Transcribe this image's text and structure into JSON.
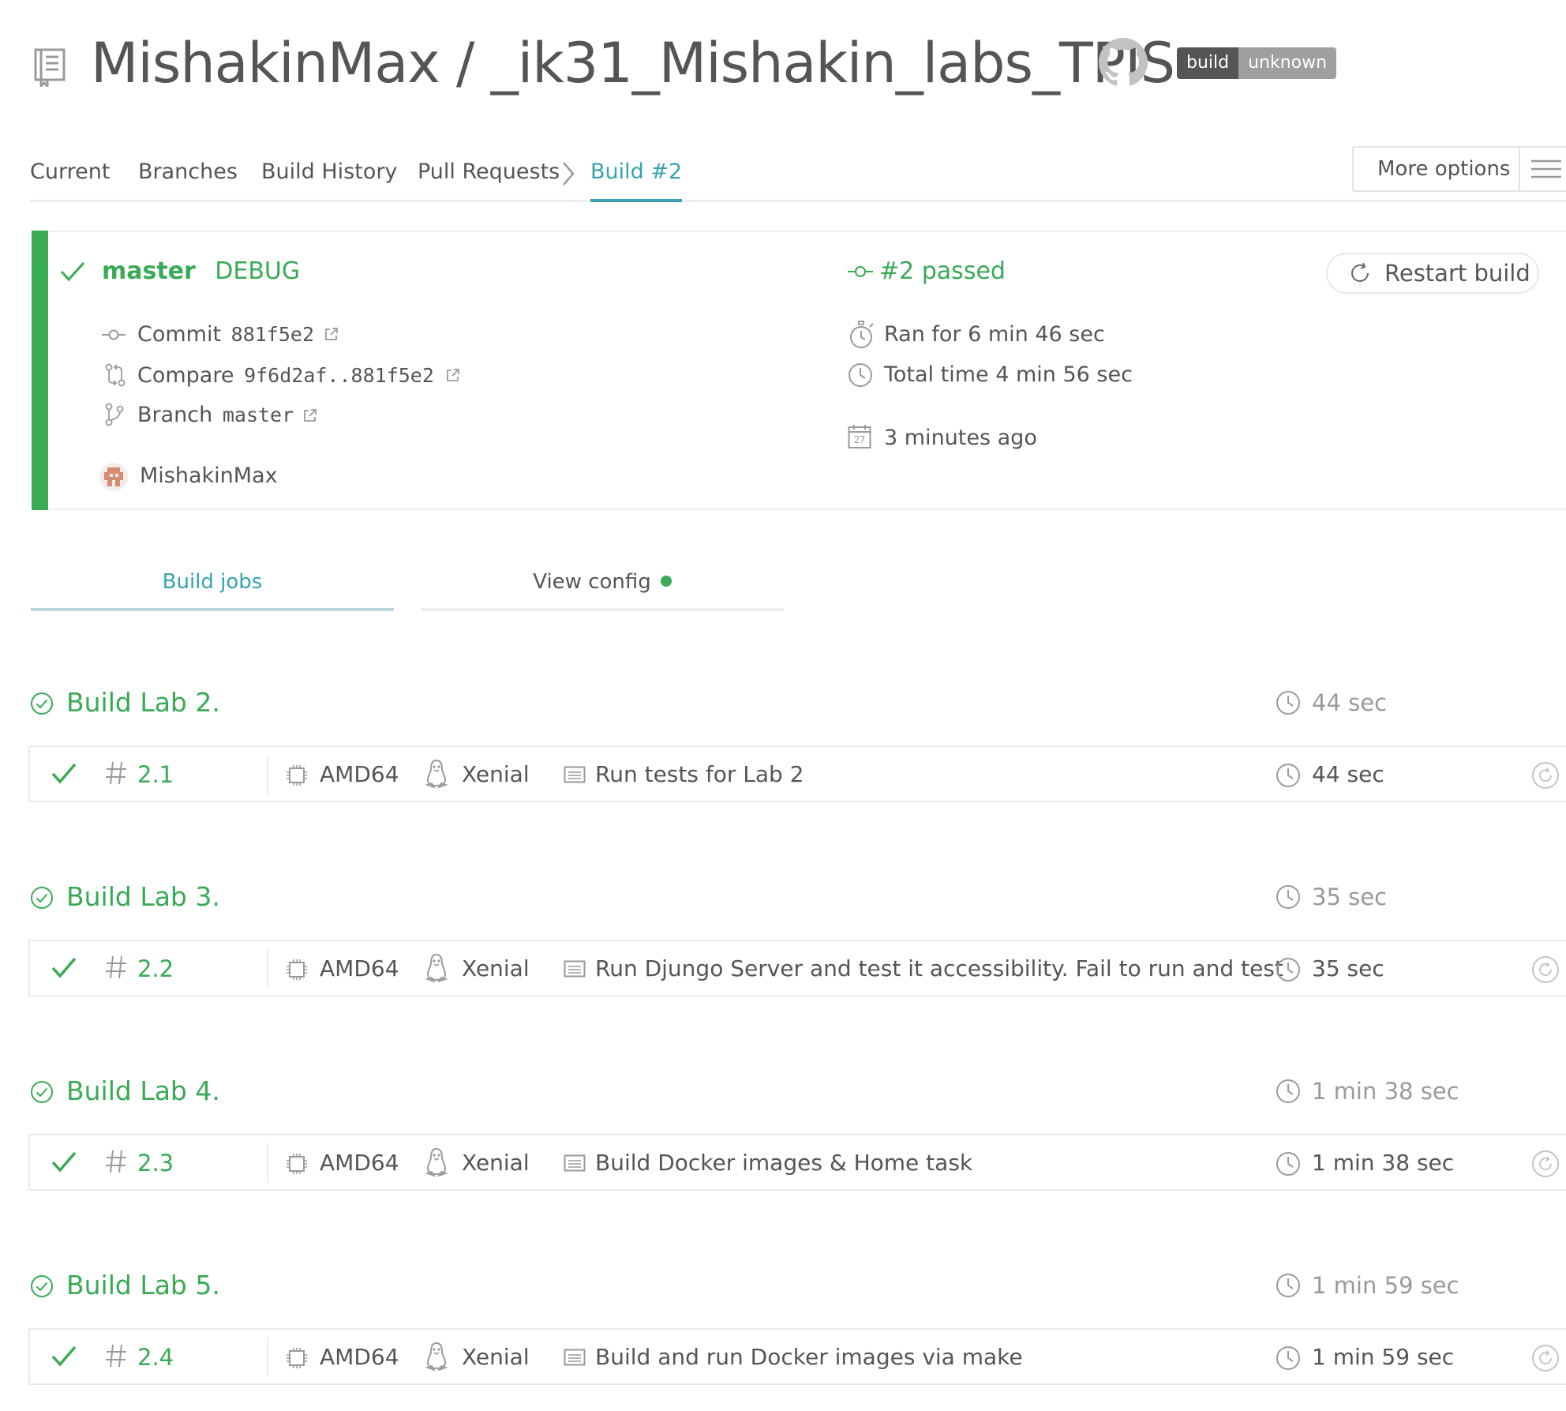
{
  "header": {
    "repo_owner": "MishakinMax",
    "separator": " / ",
    "repo_name": "_ik31_Mishakin_labs_TPIS",
    "badge": {
      "label": "build",
      "status": "unknown"
    }
  },
  "nav": {
    "tabs": [
      {
        "label": "Current"
      },
      {
        "label": "Branches"
      },
      {
        "label": "Build History"
      },
      {
        "label": "Pull Requests"
      },
      {
        "label": "Build #2",
        "active": true
      }
    ],
    "more_options": "More options"
  },
  "build": {
    "branch": "master",
    "message": "DEBUG",
    "status": "#2 passed",
    "restart_label": "Restart build",
    "commit_label": "Commit",
    "commit_hash": "881f5e2",
    "compare_label": "Compare",
    "compare_range": "9f6d2af..881f5e2",
    "branch_label": "Branch",
    "branch_name": "master",
    "author": "MishakinMax",
    "ran_for": "Ran for 6 min 46 sec",
    "total_time": "Total time 4 min 56 sec",
    "finished": "3 minutes ago",
    "calendar_day": "27"
  },
  "subtabs": {
    "jobs": "Build jobs",
    "config": "View config"
  },
  "stages": [
    {
      "title": "Build Lab 2.",
      "time": "44 sec",
      "job": {
        "number": "2.1",
        "arch": "AMD64",
        "os": "Xenial",
        "name": "Run tests for Lab 2",
        "time": "44 sec"
      }
    },
    {
      "title": "Build Lab 3.",
      "time": "35 sec",
      "job": {
        "number": "2.2",
        "arch": "AMD64",
        "os": "Xenial",
        "name": "Run Djungo Server and test it accessibility. Fail to run and test",
        "time": "35 sec"
      }
    },
    {
      "title": "Build Lab 4.",
      "time": "1 min 38 sec",
      "job": {
        "number": "2.3",
        "arch": "AMD64",
        "os": "Xenial",
        "name": "Build Docker images & Home task",
        "time": "1 min 38 sec"
      }
    },
    {
      "title": "Build Lab 5.",
      "time": "1 min 59 sec",
      "job": {
        "number": "2.4",
        "arch": "AMD64",
        "os": "Xenial",
        "name": "Build and run Docker images via make",
        "time": "1 min 59 sec"
      }
    }
  ],
  "colors": {
    "passed": "#39aa56",
    "accent": "#35a4b0",
    "text": "#555555",
    "muted": "#9a9a9a"
  },
  "icons": {
    "repo": "repo-icon",
    "github": "github-icon",
    "check": "check-icon",
    "commit": "commit-icon",
    "compare": "compare-icon",
    "branch": "branch-icon",
    "external": "external-link-icon",
    "stopwatch": "stopwatch-icon",
    "clock": "clock-icon",
    "calendar": "calendar-icon",
    "restart": "restart-icon",
    "cpu": "cpu-icon",
    "linux": "linux-icon",
    "job-name": "document-icon",
    "hash": "hash-icon",
    "menu": "menu-icon"
  }
}
